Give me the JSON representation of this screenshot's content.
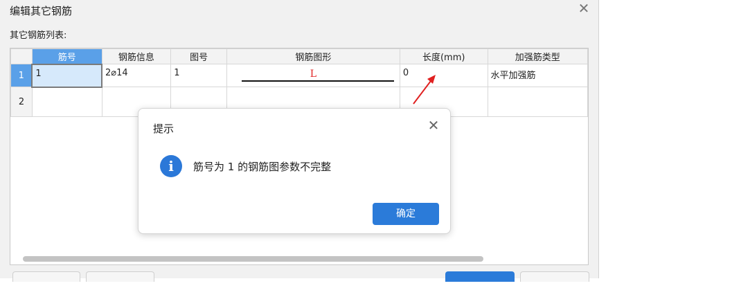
{
  "dialog": {
    "title": "编辑其它钢筋",
    "list_label": "其它钢筋列表:",
    "close_icon": "close-icon"
  },
  "table": {
    "columns": [
      "筋号",
      "钢筋信息",
      "图号",
      "钢筋图形",
      "长度(mm)",
      "加强筋类型"
    ],
    "rows": [
      {
        "row_no": "1",
        "jin_hao": "1",
        "info": "2⌀14",
        "tu_hao": "1",
        "shape_letter": "L",
        "length": "0",
        "type": "水平加强筋"
      },
      {
        "row_no": "2",
        "jin_hao": "",
        "info": "",
        "tu_hao": "",
        "shape_letter": "",
        "length": "",
        "type": ""
      }
    ]
  },
  "alert": {
    "title": "提示",
    "icon": "info-icon",
    "icon_glyph": "i",
    "message": "筋号为 1 的钢筋图参数不完整",
    "ok_label": "确定"
  },
  "colors": {
    "accent": "#2b7bd9",
    "selected_header": "#5aa0e8",
    "arrow": "#e02020"
  }
}
